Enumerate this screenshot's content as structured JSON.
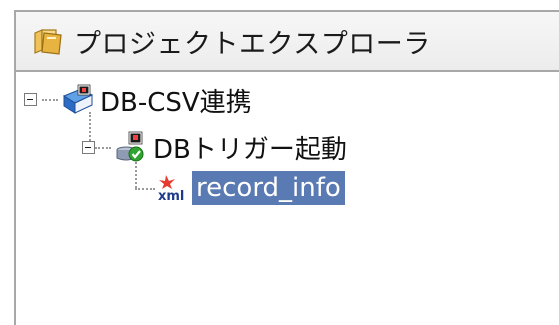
{
  "explorer": {
    "title": "プロジェクトエクスプローラ",
    "title_icon": "folder-icon"
  },
  "tree": {
    "items": [
      {
        "label": "DB-CSV連携",
        "icon": "project-book-icon",
        "expanded": true,
        "depth": 0
      },
      {
        "label": "DBトリガー起動",
        "icon": "db-trigger-icon",
        "expanded": true,
        "depth": 1
      },
      {
        "label": "record_info",
        "icon": "xml-file-icon",
        "icon_text": "xml",
        "selected": true,
        "depth": 2
      }
    ]
  },
  "colors": {
    "selection": "#5a7ab3",
    "border": "#a8a8a8"
  }
}
